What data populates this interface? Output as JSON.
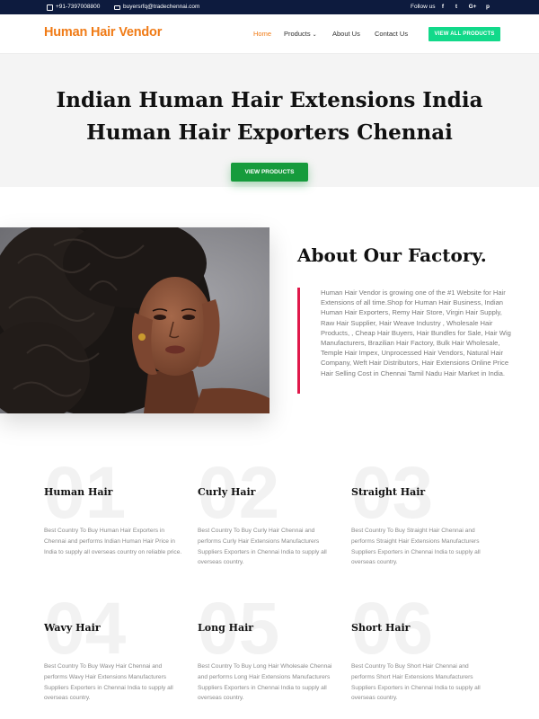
{
  "topbar": {
    "phone": "+91-7397008800",
    "email": "buyersrfq@tradechennai.com",
    "follow_label": "Follow us",
    "socials": [
      "f",
      "t",
      "G+",
      "p"
    ]
  },
  "header": {
    "logo": "Human Hair Vendor",
    "nav": [
      {
        "label": "Home",
        "active": true
      },
      {
        "label": "Products"
      },
      {
        "label": "About Us"
      },
      {
        "label": "Contact Us"
      }
    ],
    "cta": "VIEW ALL PRODUCTS"
  },
  "hero": {
    "title_line1": "Indian Human Hair Extensions India",
    "title_line2": "Human Hair Exporters Chennai",
    "button": "VIEW PRODUCTS"
  },
  "about": {
    "title": "About Our Factory.",
    "text": "Human Hair Vendor is growing one of the #1 Website for Hair Extensions of all time.Shop for Human Hair Business, Indian Human Hair Exporters, Remy Hair Store, Virgin Hair Supply, Raw Hair Supplier, Hair Weave Industry , Wholesale Hair Products, , Cheap Hair Buyers, Hair Bundles for Sale, Hair Wig Manufacturers, Brazilian Hair Factory, Bulk Hair Wholesale, Temple Hair Impex, Unprocessed Hair Vendors, Natural Hair Company, Weft Hair Distributors, Hair Extensions Online Price Hair Selling Cost in Chennai Tamil Nadu Hair Market in India."
  },
  "features": [
    {
      "num": "01",
      "title": "Human Hair",
      "desc": "Best Country To Buy Human Hair Exporters in Chennai and performs Indian Human Hair Price in India to supply all overseas country on reliable price."
    },
    {
      "num": "02",
      "title": "Curly Hair",
      "desc": "Best Country To Buy Curly Hair Chennai and performs Curly Hair Extensions Manufacturers Suppliers Exporters in Chennai India to supply all overseas country."
    },
    {
      "num": "03",
      "title": "Straight Hair",
      "desc": "Best Country To Buy Straight Hair Chennai and performs Straight Hair Extensions Manufacturers Suppliers Exporters in Chennai India to supply all overseas country."
    },
    {
      "num": "04",
      "title": "Wavy Hair",
      "desc": "Best Country To Buy Wavy Hair Chennai and performs Wavy Hair Extensions Manufacturers Suppliers Exporters in Chennai India to supply all overseas country."
    },
    {
      "num": "05",
      "title": "Long Hair",
      "desc": "Best Country To Buy Long Hair Wholesale Chennai and performs Long Hair Extensions Manufacturers Suppliers Exporters in Chennai India to supply all overseas country."
    },
    {
      "num": "06",
      "title": "Short Hair",
      "desc": "Best Country To Buy Short Hair Chennai and performs Short Hair Extensions Manufacturers Suppliers Exporters in Chennai India to supply all overseas country."
    }
  ],
  "colors": {
    "topbar": "#0d1b3e",
    "brand": "#f07b16",
    "cta": "#12d98a",
    "hero_button": "#169b3c",
    "accent_bar": "#e0184a"
  }
}
